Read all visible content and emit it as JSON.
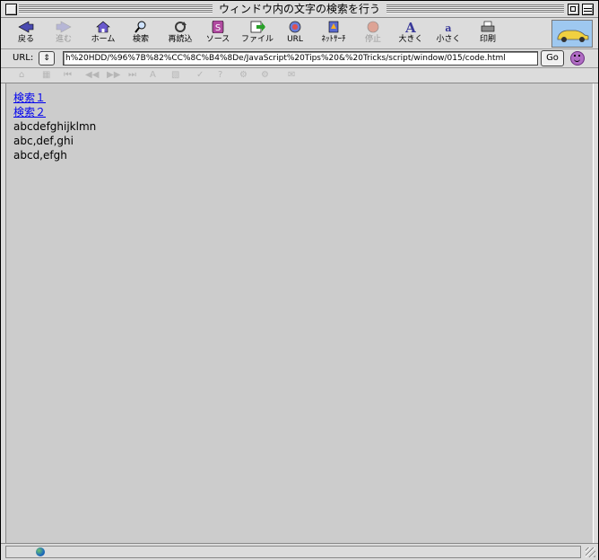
{
  "window": {
    "title": "ウィンドウ内の文字の検索を行う"
  },
  "toolbar": {
    "items": [
      {
        "label": "戻る",
        "icon": "back-arrow-icon",
        "enabled": true
      },
      {
        "label": "進む",
        "icon": "forward-arrow-icon",
        "enabled": false
      },
      {
        "label": "ホーム",
        "icon": "home-icon",
        "enabled": true
      },
      {
        "label": "検索",
        "icon": "magnifier-icon",
        "enabled": true
      },
      {
        "label": "再読込",
        "icon": "reload-icon",
        "enabled": true
      },
      {
        "label": "ソース",
        "icon": "source-icon",
        "enabled": true
      },
      {
        "label": "ファイル",
        "icon": "file-icon",
        "enabled": true
      },
      {
        "label": "URL",
        "icon": "url-globe-icon",
        "enabled": true
      },
      {
        "label": "ﾈｯﾄｻｰﾁ",
        "icon": "net-search-icon",
        "enabled": true
      },
      {
        "label": "停止",
        "icon": "stop-icon",
        "enabled": false
      },
      {
        "label": "大きく",
        "icon": "bigger-font-icon",
        "enabled": true
      },
      {
        "label": "小さく",
        "icon": "smaller-font-icon",
        "enabled": true
      },
      {
        "label": "印刷",
        "icon": "print-icon",
        "enabled": true
      }
    ]
  },
  "urlbar": {
    "label": "URL:",
    "value": "h%20HDD/%96%7B%82%CC%8C%B4%8De/JavaScript%20Tips%20&%20Tricks/script/window/015/code.html",
    "go_label": "Go"
  },
  "content": {
    "links": [
      "検索１",
      "検索２"
    ],
    "lines": [
      "abcdefghijklmn",
      "abc,def,ghi",
      "abcd,efgh"
    ]
  },
  "colors": {
    "chrome": "#dcdcdc",
    "content_bg": "#cccccc",
    "link": "#0000ee"
  }
}
